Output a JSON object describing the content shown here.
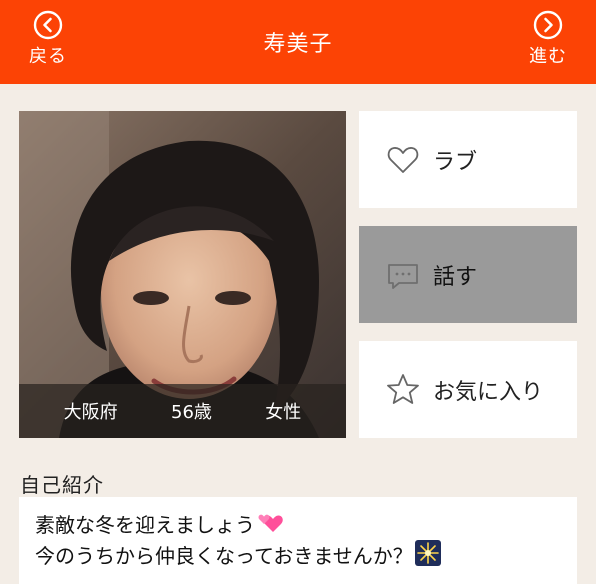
{
  "header": {
    "back_label": "戻る",
    "forward_label": "進む",
    "title": "寿美子",
    "background_color": "#fc4305"
  },
  "profile": {
    "location": "大阪府",
    "age": "56歳",
    "gender": "女性"
  },
  "actions": {
    "love_label": "ラブ",
    "talk_label": "話す",
    "favorite_label": "お気に入り"
  },
  "intro": {
    "heading": "自己紹介",
    "line1": "素敵な冬を迎えましょう",
    "line2": "今のうちから仲良くなっておきませんか？"
  },
  "icons": {
    "back": "chevron-left-circle-icon",
    "forward": "chevron-right-circle-icon",
    "love": "heart-outline-icon",
    "talk": "chat-bubble-icon",
    "favorite": "star-outline-icon",
    "emoji_hearts": "two-hearts-emoji",
    "emoji_sparkler": "sparkler-emoji"
  }
}
